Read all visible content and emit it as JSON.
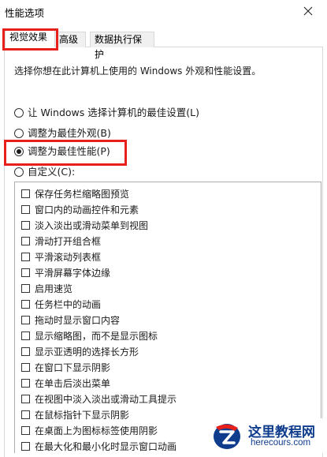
{
  "window": {
    "title": "性能选项"
  },
  "tabs": [
    {
      "label": "视觉效果"
    },
    {
      "label": "高级"
    },
    {
      "label": "数据执行保护"
    }
  ],
  "visual": {
    "description": "选择你想在此计算机上使用的 Windows 外观和性能设置。",
    "radios": [
      {
        "label": "让 Windows 选择计算机的最佳设置(L)",
        "checked": false
      },
      {
        "label": "调整为最佳外观(B)",
        "checked": false
      },
      {
        "label": "调整为最佳性能(P)",
        "checked": true
      },
      {
        "label": "自定义(C):",
        "checked": false
      }
    ],
    "options": [
      "保存任务栏缩略图预览",
      "窗口内的动画控件和元素",
      "淡入淡出或滑动菜单到视图",
      "滑动打开组合框",
      "平滑滚动列表框",
      "平滑屏幕字体边缘",
      "启用速览",
      "任务栏中的动画",
      "拖动时显示窗口内容",
      "显示缩略图，而不是显示图标",
      "显示亚透明的选择长方形",
      "在窗口下显示阴影",
      "在单击后淡出菜单",
      "在视图中淡入淡出或滑动工具提示",
      "在鼠标指针下显示阴影",
      "在桌面上为图标标签使用阴影",
      "在最大化和最小化时显示窗口动画"
    ]
  },
  "watermark": {
    "title": "这里教程网",
    "url": "herecours.com"
  },
  "colors": {
    "highlight": "#e8201c",
    "brand": "#0f3c8c"
  }
}
